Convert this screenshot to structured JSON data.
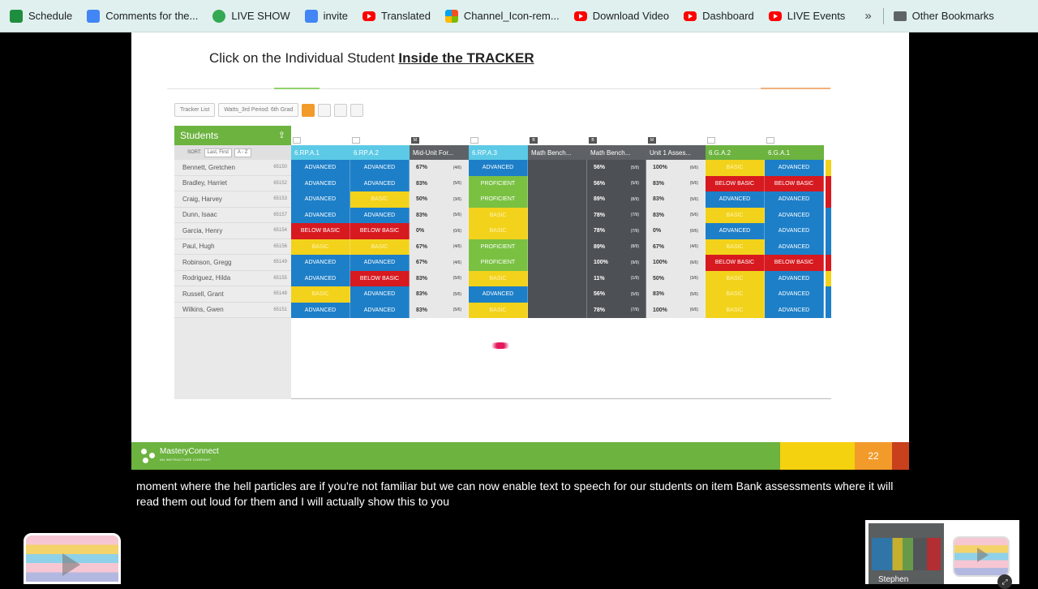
{
  "bookmarks": [
    {
      "label": "Schedule",
      "icon": "sheets-icon"
    },
    {
      "label": "Comments for the...",
      "icon": "docs-icon"
    },
    {
      "label": "LIVE SHOW",
      "icon": "live-icon"
    },
    {
      "label": "invite",
      "icon": "docs-icon"
    },
    {
      "label": "Translated",
      "icon": "youtube-icon"
    },
    {
      "label": "Channel_Icon-rem...",
      "icon": "microsoft-icon"
    },
    {
      "label": "Download Video",
      "icon": "youtube-icon"
    },
    {
      "label": "Dashboard",
      "icon": "youtube-icon"
    },
    {
      "label": "LIVE Events",
      "icon": "youtube-icon"
    }
  ],
  "bookmarks_more": "»",
  "other_bookmarks": "Other Bookmarks",
  "slide": {
    "title_prefix": "Click on the Individual Student ",
    "title_emphasis": "Inside the TRACKER",
    "page_number": "22",
    "logo_text": "MasteryConnect",
    "logo_sub": "AN INSTRUCTURE COMPANY"
  },
  "tracker": {
    "tracker_list": "Tracker List",
    "tracker_name": "Watts_3rd Period: 6th Grad",
    "students_header": "Students",
    "sort_label": "SORT:",
    "sort_value": "Last, First",
    "order_value": "A - Z",
    "students": [
      {
        "name": "Bennett, Gretchen",
        "id": "65150"
      },
      {
        "name": "Bradley, Harriet",
        "id": "65152"
      },
      {
        "name": "Craig, Harvey",
        "id": "65153"
      },
      {
        "name": "Dunn, Isaac",
        "id": "65157"
      },
      {
        "name": "Garcia, Henry",
        "id": "65154"
      },
      {
        "name": "Paul, Hugh",
        "id": "65156"
      },
      {
        "name": "Robinson, Gregg",
        "id": "65149"
      },
      {
        "name": "Rodriguez, Hilda",
        "id": "65155"
      },
      {
        "name": "Russell, Grant",
        "id": "65148"
      },
      {
        "name": "Wilkins, Gwen",
        "id": "65151"
      }
    ],
    "columns": [
      {
        "header": "6.RP.A.1",
        "style": "blue",
        "tag": "",
        "kind": "mastery",
        "cells": [
          "ADVANCED",
          "ADVANCED",
          "ADVANCED",
          "ADVANCED",
          "BELOW BASIC",
          "BASIC",
          "ADVANCED",
          "ADVANCED",
          "BASIC",
          "ADVANCED"
        ]
      },
      {
        "header": "6.RP.A.2",
        "style": "blue",
        "tag": "",
        "kind": "mastery",
        "cells": [
          "ADVANCED",
          "ADVANCED",
          "BASIC",
          "ADVANCED",
          "BELOW BASIC",
          "BASIC",
          "ADVANCED",
          "BELOW BASIC",
          "ADVANCED",
          "ADVANCED"
        ]
      },
      {
        "header": "Mid-Unit For...",
        "style": "grey",
        "tag": "M",
        "kind": "pct",
        "cells": [
          [
            "67%",
            "(4/6)"
          ],
          [
            "83%",
            "(5/6)"
          ],
          [
            "50%",
            "(3/6)"
          ],
          [
            "83%",
            "(5/6)"
          ],
          [
            "0%",
            "(0/6)"
          ],
          [
            "67%",
            "(4/6)"
          ],
          [
            "67%",
            "(4/6)"
          ],
          [
            "83%",
            "(5/6)"
          ],
          [
            "83%",
            "(5/6)"
          ],
          [
            "83%",
            "(5/6)"
          ]
        ]
      },
      {
        "header": "6.RP.A.3",
        "style": "blue",
        "tag": "",
        "kind": "mastery",
        "cells": [
          "ADVANCED",
          "PROFICIENT",
          "PROFICIENT",
          "BASIC",
          "BASIC",
          "PROFICIENT",
          "PROFICIENT",
          "BASIC",
          "ADVANCED",
          "BASIC"
        ]
      },
      {
        "header": "Math Bench...",
        "style": "grey",
        "tag": "B",
        "kind": "empty",
        "cells": [
          "",
          "",
          "",
          "",
          "",
          "",
          "",
          "",
          "",
          ""
        ]
      },
      {
        "header": "Math Bench...",
        "style": "grey",
        "tag": "B",
        "kind": "dark",
        "cells": [
          [
            "56%",
            "(5/9)"
          ],
          [
            "56%",
            "(5/9)"
          ],
          [
            "89%",
            "(8/9)"
          ],
          [
            "78%",
            "(7/9)"
          ],
          [
            "78%",
            "(7/9)"
          ],
          [
            "89%",
            "(8/9)"
          ],
          [
            "100%",
            "(9/9)"
          ],
          [
            "11%",
            "(1/9)"
          ],
          [
            "56%",
            "(5/9)"
          ],
          [
            "78%",
            "(7/9)"
          ]
        ]
      },
      {
        "header": "Unit 1 Asses...",
        "style": "grey",
        "tag": "M",
        "kind": "pct",
        "cells": [
          [
            "100%",
            "(6/6)"
          ],
          [
            "83%",
            "(5/6)"
          ],
          [
            "83%",
            "(5/6)"
          ],
          [
            "83%",
            "(5/6)"
          ],
          [
            "0%",
            "(0/6)"
          ],
          [
            "67%",
            "(4/6)"
          ],
          [
            "100%",
            "(6/6)"
          ],
          [
            "50%",
            "(3/6)"
          ],
          [
            "83%",
            "(5/6)"
          ],
          [
            "100%",
            "(6/6)"
          ]
        ]
      },
      {
        "header": "6.G.A.2",
        "style": "green",
        "tag": "",
        "kind": "mastery",
        "cells": [
          "BASIC",
          "BELOW BASIC",
          "ADVANCED",
          "BASIC",
          "ADVANCED",
          "BASIC",
          "BELOW BASIC",
          "BASIC",
          "BASIC",
          "BASIC"
        ]
      },
      {
        "header": "6.G.A.1",
        "style": "green",
        "tag": "",
        "kind": "mastery",
        "cells": [
          "ADVANCED",
          "BELOW BASIC",
          "ADVANCED",
          "ADVANCED",
          "ADVANCED",
          "ADVANCED",
          "BELOW BASIC",
          "ADVANCED",
          "ADVANCED",
          "ADVANCED"
        ]
      }
    ],
    "edge_column": [
      "BASIC",
      "BELOW BASIC",
      "BELOW BASIC",
      "ADVANCED",
      "ADVANCED",
      "ADVANCED",
      "BELOW BASIC",
      "BASIC",
      "ADVANCED",
      "ADVANCED"
    ]
  },
  "caption": "moment where the hell particles are if you're not familiar but we can now enable text to speech for our students on item Bank assessments where it will read them out loud for them and I will actually show this to you",
  "participant": {
    "name": "Stephen"
  },
  "colors": {
    "advanced": "#1d7fc8",
    "proficient": "#7ac142",
    "basic": "#f2d21b",
    "below_basic": "#d71920",
    "brand_green": "#6cb33f"
  }
}
